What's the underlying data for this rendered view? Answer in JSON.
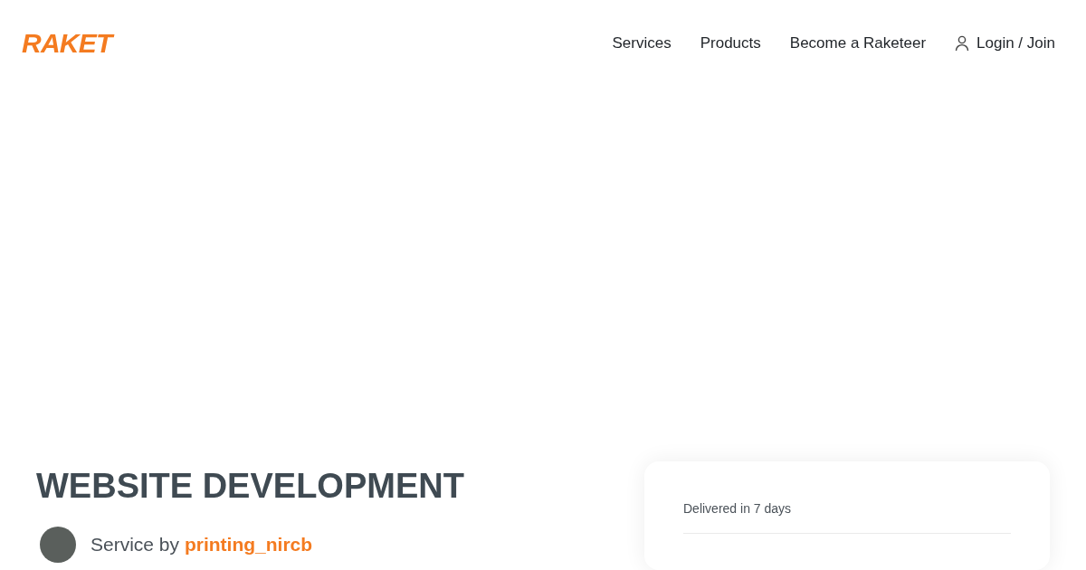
{
  "header": {
    "logo": "RAKET",
    "nav": [
      {
        "label": "Services",
        "kind": "link"
      },
      {
        "label": "Products",
        "kind": "link"
      },
      {
        "label": "Become a Raketeer",
        "kind": "link"
      },
      {
        "label": "Login / Join",
        "kind": "account"
      }
    ]
  },
  "service": {
    "title": "WEBSITE DEVELOPMENT",
    "by_label": "Service by",
    "seller": "printing_nircb"
  },
  "order_card": {
    "delivery": "Delivered in 7 days"
  }
}
